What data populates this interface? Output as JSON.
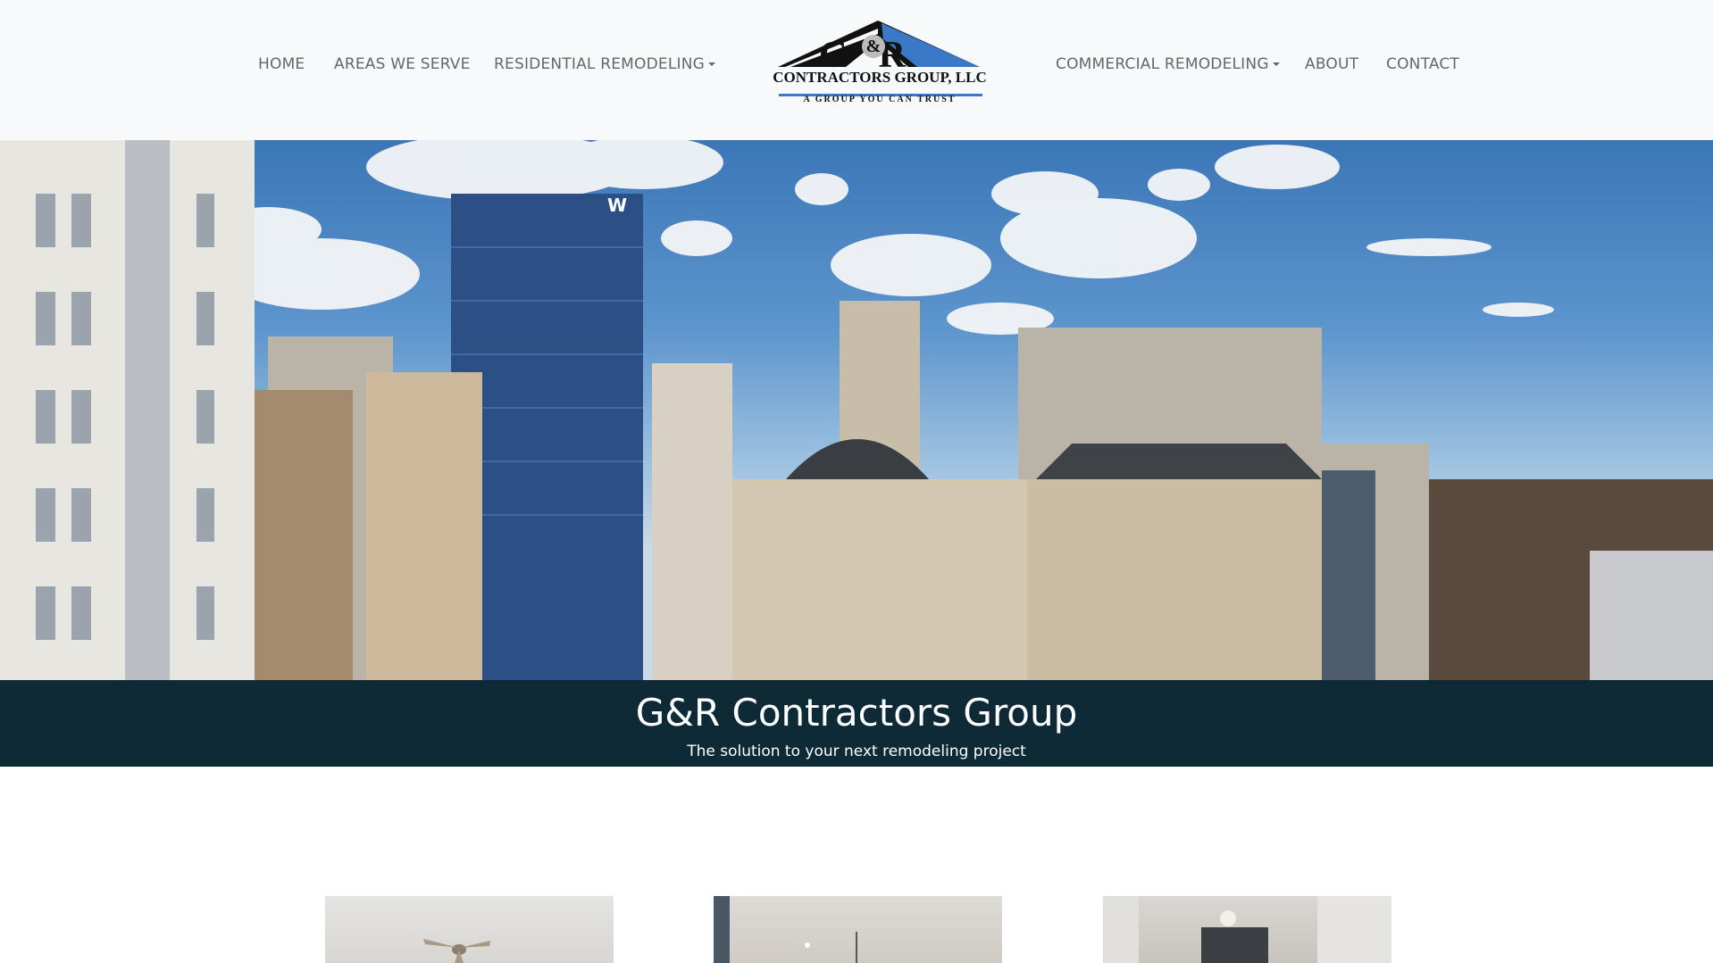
{
  "nav": {
    "left": [
      {
        "label": "HOME",
        "dropdown": false
      },
      {
        "label": "AREAS WE SERVE",
        "dropdown": false
      },
      {
        "label": "RESIDENTIAL REMODELING",
        "dropdown": true
      }
    ],
    "right": [
      {
        "label": "COMMERCIAL REMODELING",
        "dropdown": true
      },
      {
        "label": "ABOUT",
        "dropdown": false
      },
      {
        "label": "CONTACT",
        "dropdown": false
      }
    ]
  },
  "logo": {
    "initials_g": "G",
    "initials_amp": "&",
    "initials_r": "R",
    "company": "CONTRACTORS GROUP, LLC",
    "tagline": "A GROUP YOU CAN TRUST",
    "roof_color": "#3a78c8"
  },
  "hero": {
    "image": "city-skyline-photo"
  },
  "banner": {
    "title": "G&R Contractors Group",
    "subtitle": "The solution to your next remodeling project",
    "background": "#0d2a36"
  },
  "cards": [
    {
      "image": "living-room-ceiling-fan-photo"
    },
    {
      "image": "dining-room-pendant-photo"
    },
    {
      "image": "bathroom-vanity-light-photo"
    }
  ]
}
